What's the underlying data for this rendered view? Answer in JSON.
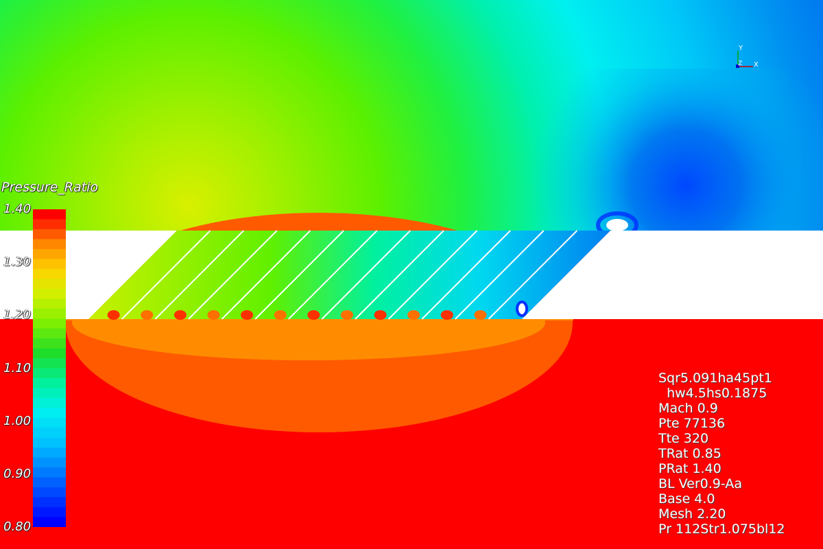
{
  "chart_data": {
    "type": "heatmap",
    "title": "Pressure_Ratio",
    "colorbar": {
      "min": 0.8,
      "max": 1.4,
      "ticks": [
        "1.40",
        "1.30",
        "1.20",
        "1.10",
        "1.00",
        "0.90",
        "0.80"
      ],
      "tick_values": [
        1.4,
        1.3,
        1.2,
        1.1,
        1.0,
        0.9,
        0.8
      ],
      "colormap": "rainbow (blue → cyan → green → yellow → orange → red)",
      "discrete_bands": 32
    },
    "field_summary": {
      "upper_region": "green (~1.12) at upper-left grading to blue (~0.85) at upper-right",
      "lower_plenum": "red (~1.40) with orange (~1.33) pocket beneath slot exits",
      "slots": 14,
      "slot_angle_deg": 45
    }
  },
  "axis_triad": {
    "y_label": "Y",
    "z_label": "Z",
    "x_label": "X"
  },
  "info_lines": [
    "Sqr5.091ha45pt1",
    "  hw4.5hs0.1875",
    "Mach 0.9",
    "Pte 77136",
    "Tte 320",
    "TRat 0.85",
    "PRat 1.40",
    "BL Ver0.9-Aa",
    "Base 4.0",
    "Mesh 2.20",
    "Pr 112Str1.075bl12"
  ],
  "colors": {
    "plenum": "#ff0000",
    "wall": "#ffffff",
    "text": "#ffffff"
  }
}
